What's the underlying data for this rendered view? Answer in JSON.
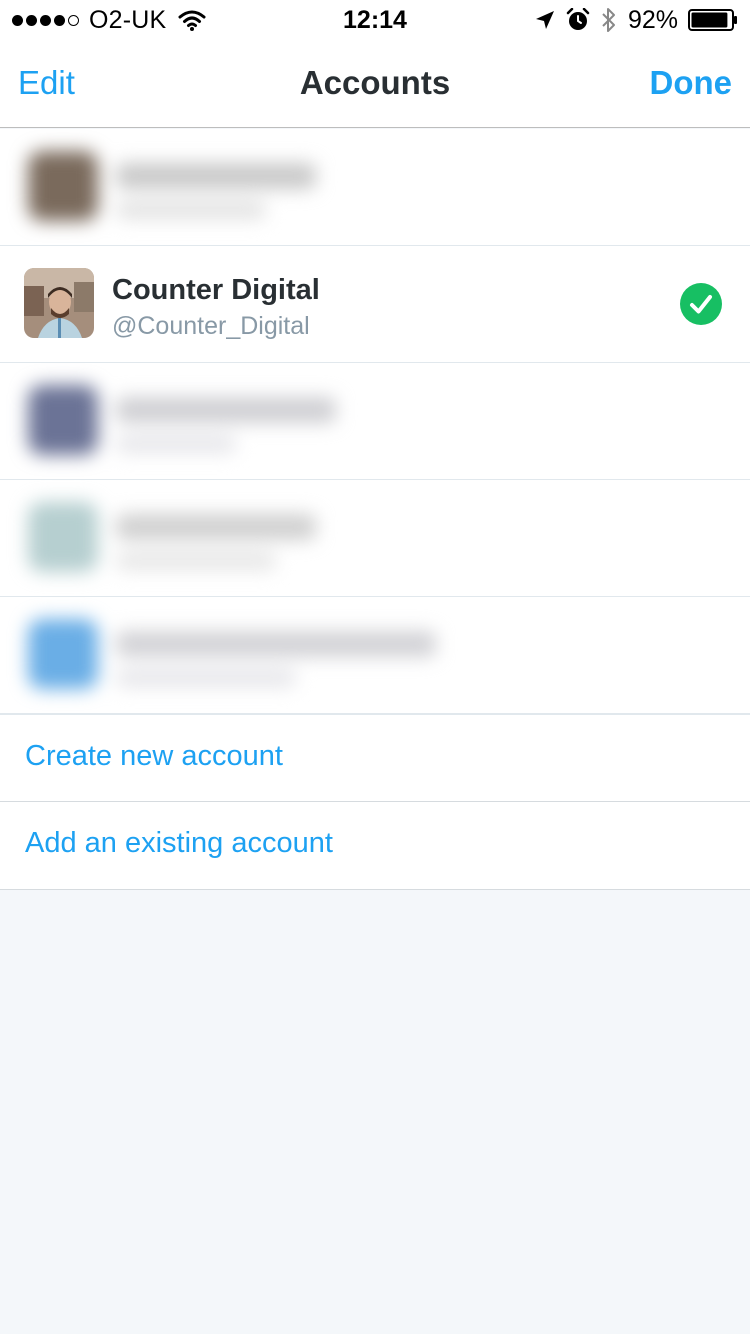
{
  "status_bar": {
    "carrier": "O2-UK",
    "time": "12:14",
    "battery_percent": "92%",
    "signal_strength": 4,
    "signal_max": 5,
    "battery_level": 0.92,
    "icons": [
      "signal-dots-icon",
      "wifi-icon",
      "location-arrow-icon",
      "alarm-icon",
      "bluetooth-icon",
      "battery-icon"
    ]
  },
  "nav": {
    "edit_label": "Edit",
    "title": "Accounts",
    "done_label": "Done"
  },
  "accounts": [
    {
      "name": "",
      "handle": "",
      "blurred": true,
      "selected": false,
      "avatar_color": "#7a6a5c",
      "line_color": "#bfbfbf"
    },
    {
      "name": "Counter Digital",
      "handle": "@Counter_Digital",
      "blurred": false,
      "selected": true
    },
    {
      "name": "",
      "handle": "",
      "blurred": true,
      "selected": false,
      "avatar_color": "#6b7396",
      "line_color": "#c4c4c8"
    },
    {
      "name": "",
      "handle": "",
      "blurred": true,
      "selected": false,
      "avatar_color": "#b6cfd0",
      "line_color": "#c6c6c6"
    },
    {
      "name": "",
      "handle": "",
      "blurred": true,
      "selected": false,
      "avatar_color": "#6aaee6",
      "line_color": "#c8c8cc"
    }
  ],
  "actions": {
    "create_label": "Create new account",
    "add_label": "Add an existing account"
  },
  "colors": {
    "accent": "#1da1f2",
    "check_green": "#17bf63",
    "background": "#f4f7fa"
  }
}
